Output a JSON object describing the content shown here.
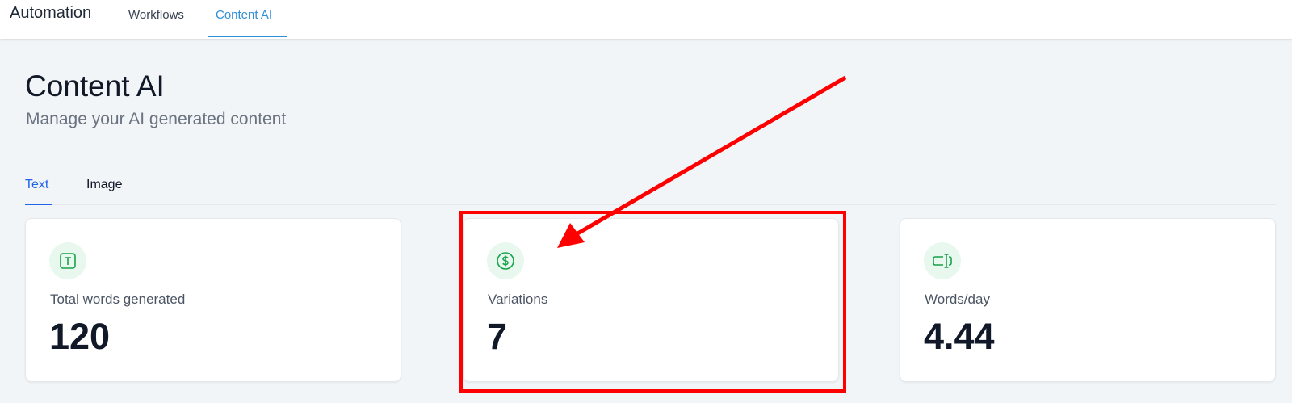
{
  "header": {
    "app_title": "Automation",
    "nav": [
      "Workflows",
      "Content AI"
    ],
    "active_nav": "Content AI"
  },
  "page": {
    "title": "Content AI",
    "subtitle": "Manage your AI generated content"
  },
  "tabs": {
    "items": [
      "Text",
      "Image"
    ],
    "active": "Text"
  },
  "stats": [
    {
      "label": "Total words generated",
      "value": "120",
      "icon": "text-icon"
    },
    {
      "label": "Variations",
      "value": "7",
      "icon": "dollar-icon"
    },
    {
      "label": "Words/day",
      "value": "4.44",
      "icon": "text-cursor-icon"
    }
  ],
  "annotation": {
    "color": "#ff0000",
    "highlighted": "Variations"
  },
  "colors": {
    "accent": "#2f8fd6",
    "tab_active": "#2563eb",
    "icon_green": "#16a34a",
    "icon_bg": "#e8f8ee"
  }
}
